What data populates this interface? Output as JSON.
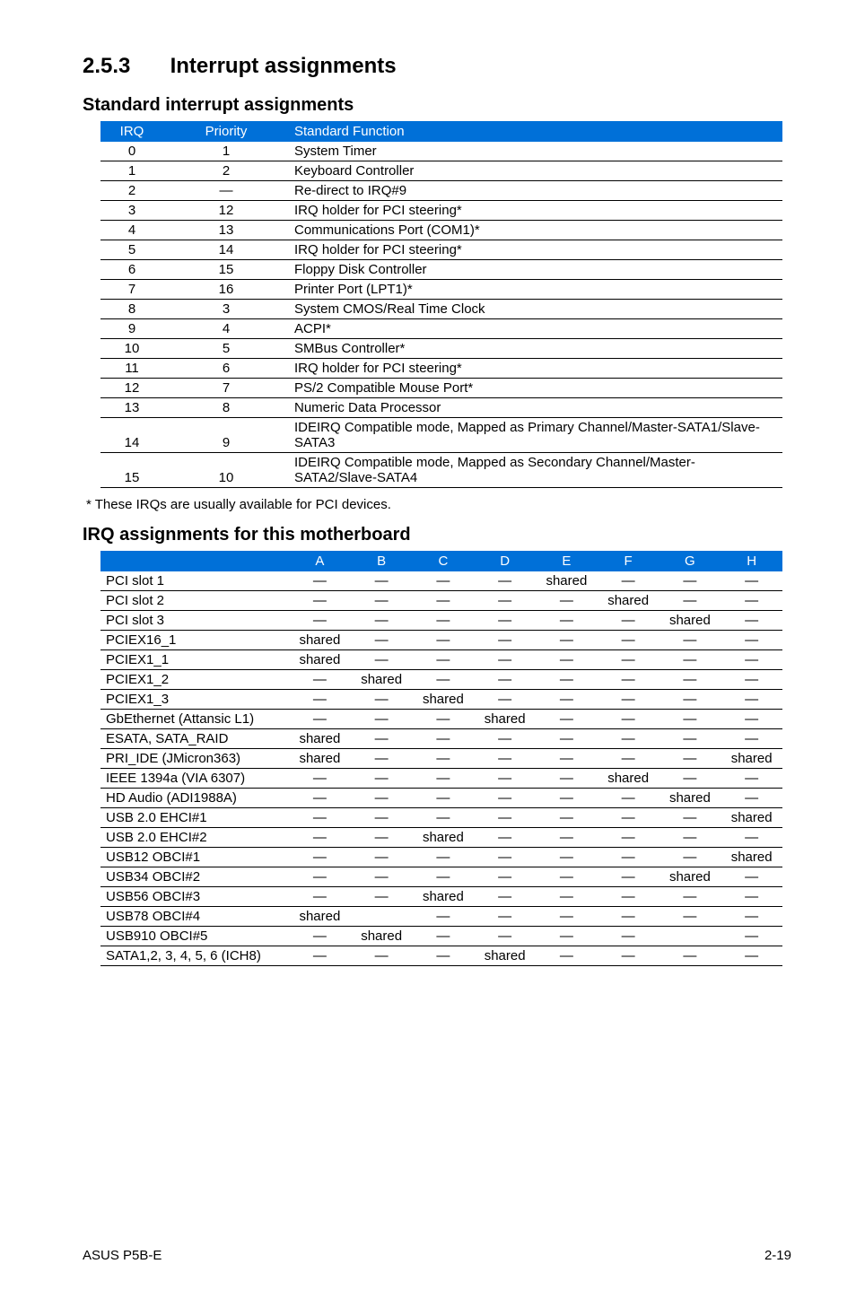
{
  "section": {
    "number": "2.5.3",
    "title": "Interrupt assignments"
  },
  "std_block": {
    "heading": "Standard interrupt assignments",
    "headers": [
      "IRQ",
      "Priority",
      "Standard Function"
    ],
    "rows": [
      [
        "0",
        "1",
        "System Timer"
      ],
      [
        "1",
        "2",
        "Keyboard Controller"
      ],
      [
        "2",
        "—",
        "Re-direct to IRQ#9"
      ],
      [
        "3",
        "12",
        "IRQ holder for PCI steering*"
      ],
      [
        "4",
        "13",
        "Communications Port (COM1)*"
      ],
      [
        "5",
        "14",
        "IRQ holder for PCI steering*"
      ],
      [
        "6",
        "15",
        "Floppy Disk Controller"
      ],
      [
        "7",
        "16",
        "Printer Port (LPT1)*"
      ],
      [
        "8",
        "3",
        "System CMOS/Real Time Clock"
      ],
      [
        "9",
        "4",
        "ACPI*"
      ],
      [
        "10",
        "5",
        "SMBus Controller*"
      ],
      [
        "11",
        "6",
        "IRQ holder for PCI steering*"
      ],
      [
        "12",
        "7",
        "PS/2 Compatible Mouse Port*"
      ],
      [
        "13",
        "8",
        "Numeric Data Processor"
      ],
      [
        "14",
        "9",
        "IDEIRQ Compatible mode, Mapped as Primary Channel/Master-SATA1/Slave-SATA3"
      ],
      [
        "15",
        "10",
        "IDEIRQ Compatible mode, Mapped as Secondary Channel/Master-SATA2/Slave-SATA4"
      ]
    ],
    "note": "* These IRQs are usually available for PCI devices."
  },
  "irq_block": {
    "heading": "IRQ assignments for this motherboard",
    "headers": [
      "",
      "A",
      "B",
      "C",
      "D",
      "E",
      "F",
      "G",
      "H"
    ],
    "rows": [
      [
        "PCI slot 1",
        "—",
        "—",
        "—",
        "—",
        "shared",
        "—",
        "—",
        "—"
      ],
      [
        "PCI slot 2",
        "—",
        "—",
        "—",
        "—",
        "—",
        "shared",
        "—",
        "—"
      ],
      [
        "PCI slot 3",
        "—",
        "—",
        "—",
        "—",
        "—",
        "—",
        "shared",
        "—"
      ],
      [
        "PCIEX16_1",
        "shared",
        "—",
        "—",
        "—",
        "—",
        "—",
        "—",
        "—"
      ],
      [
        "PCIEX1_1",
        "shared",
        "—",
        "—",
        "—",
        "—",
        "—",
        "—",
        "—"
      ],
      [
        "PCIEX1_2",
        "—",
        "shared",
        "—",
        "—",
        "—",
        "—",
        "—",
        "—"
      ],
      [
        "PCIEX1_3",
        "—",
        "—",
        "shared",
        "—",
        "—",
        "—",
        "—",
        "—"
      ],
      [
        "GbEthernet (Attansic L1)",
        "—",
        "—",
        "—",
        "shared",
        "—",
        "—",
        "—",
        "—"
      ],
      [
        "ESATA, SATA_RAID",
        "shared",
        "—",
        "—",
        "—",
        "—",
        "—",
        "—",
        "—"
      ],
      [
        "PRI_IDE (JMicron363)",
        "shared",
        "—",
        "—",
        "—",
        "—",
        "—",
        "—",
        "shared"
      ],
      [
        "IEEE 1394a (VIA 6307)",
        "—",
        "—",
        "—",
        "—",
        "—",
        "shared",
        "—",
        "—"
      ],
      [
        "HD Audio (ADI1988A)",
        "—",
        "—",
        "—",
        "—",
        "—",
        "—",
        "shared",
        "—"
      ],
      [
        "USB 2.0 EHCI#1",
        "—",
        "—",
        "—",
        "—",
        "—",
        "—",
        "—",
        "shared"
      ],
      [
        "USB 2.0 EHCI#2",
        "—",
        "—",
        "shared",
        "—",
        "—",
        "—",
        "—",
        "—"
      ],
      [
        "USB12 OBCI#1",
        "—",
        "—",
        "—",
        "—",
        "—",
        "—",
        "—",
        "shared"
      ],
      [
        "USB34 OBCI#2",
        "—",
        "—",
        "—",
        "—",
        "—",
        "—",
        "shared",
        "—"
      ],
      [
        "USB56 OBCI#3",
        "—",
        "—",
        "shared",
        "—",
        "—",
        "—",
        "—",
        "—"
      ],
      [
        "USB78 OBCI#4",
        "shared",
        "",
        "—",
        "—",
        "—",
        "—",
        "—",
        "—"
      ],
      [
        "USB910 OBCI#5",
        "—",
        "shared",
        "—",
        "—",
        "—",
        "—",
        "",
        "—"
      ],
      [
        "SATA1,2, 3, 4, 5, 6 (ICH8)",
        "—",
        "—",
        "—",
        "shared",
        "—",
        "—",
        "—",
        "—"
      ]
    ]
  },
  "footer": {
    "left": "ASUS P5B-E",
    "right": "2-19"
  }
}
